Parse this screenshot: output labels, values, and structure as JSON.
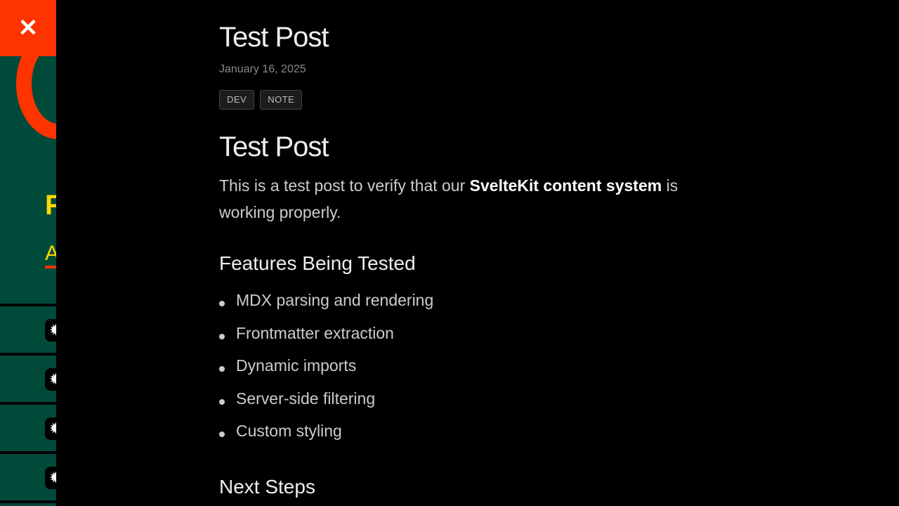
{
  "sidebar": {
    "close_icon": "close-icon",
    "peek_title": "F",
    "peek_link": "A",
    "rows": [
      {
        "icon": "starburst-icon"
      },
      {
        "icon": "starburst-icon"
      },
      {
        "icon": "starburst-icon"
      },
      {
        "icon": "starburst-icon"
      }
    ]
  },
  "post": {
    "title": "Test Post",
    "date": "January 16, 2025",
    "tags": [
      "DEV",
      "NOTE"
    ],
    "heading": "Test Post",
    "intro_before": "This is a test post to verify that our ",
    "intro_bold": "SvelteKit content system",
    "intro_after": " is working properly.",
    "features_heading": "Features Being Tested",
    "features": [
      "MDX parsing and rendering",
      "Frontmatter extraction",
      "Dynamic imports",
      "Server-side filtering",
      "Custom styling"
    ],
    "next_heading": "Next Steps"
  }
}
